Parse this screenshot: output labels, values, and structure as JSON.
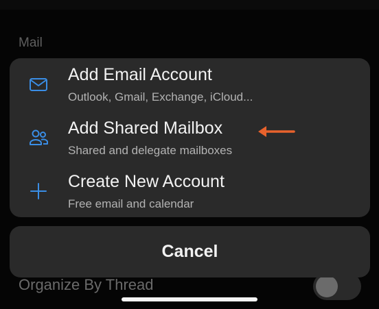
{
  "background": {
    "section_label": "Mail",
    "row_label": "Organize By Thread"
  },
  "sheet": {
    "items": [
      {
        "title": "Add Email Account",
        "subtitle": "Outlook, Gmail, Exchange, iCloud...",
        "icon": "envelope-icon"
      },
      {
        "title": "Add Shared Mailbox",
        "subtitle": "Shared and delegate mailboxes",
        "icon": "people-icon"
      },
      {
        "title": "Create New Account",
        "subtitle": "Free email and calendar",
        "icon": "plus-icon"
      }
    ]
  },
  "cancel_label": "Cancel",
  "colors": {
    "accent_blue": "#3a8ee6",
    "annotation_arrow": "#e8622c",
    "sheet_background": "#2a2a2a"
  }
}
